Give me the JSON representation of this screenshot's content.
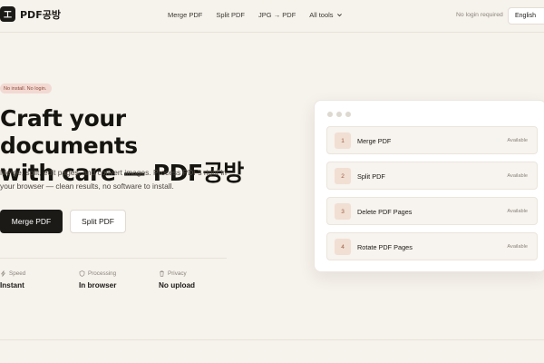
{
  "brand": {
    "mark": "工",
    "name": "PDF공방"
  },
  "nav": {
    "items": [
      {
        "label": "Merge PDF"
      },
      {
        "label": "Split PDF"
      },
      {
        "label": "JPG → PDF"
      },
      {
        "label": "All tools"
      }
    ],
    "all_tools_icon": "chevron-down-icon"
  },
  "header": {
    "login_note": "No login required",
    "language": "English"
  },
  "hero": {
    "badge": "No install. No login.",
    "title_line1": "Craft your documents",
    "title_line2": "with care — PDF공방",
    "subtitle": "Merge, split, edit pages, and convert images. Process PDFs right in your browser — clean results, no software to install.",
    "primary_button": "Merge PDF",
    "secondary_button": "Split PDF"
  },
  "stats": [
    {
      "label": "Speed",
      "value": "Instant",
      "icon": "bolt-icon"
    },
    {
      "label": "Processing",
      "value": "In browser",
      "icon": "shield-icon"
    },
    {
      "label": "Privacy",
      "value": "No upload",
      "icon": "trash-icon"
    }
  ],
  "tools": [
    {
      "num": "1",
      "name": "Merge PDF",
      "status": "Available"
    },
    {
      "num": "2",
      "name": "Split PDF",
      "status": "Available"
    },
    {
      "num": "3",
      "name": "Delete PDF Pages",
      "status": "Available"
    },
    {
      "num": "4",
      "name": "Rotate PDF Pages",
      "status": "Available"
    }
  ],
  "colors": {
    "background": "#f6f2ec",
    "primary": "#1c1a17",
    "badge_bg": "#f2d9d2",
    "badge_text": "#8f4c3d",
    "tool_num_bg": "#f1dfd3",
    "tool_num_text": "#9d5b42"
  }
}
